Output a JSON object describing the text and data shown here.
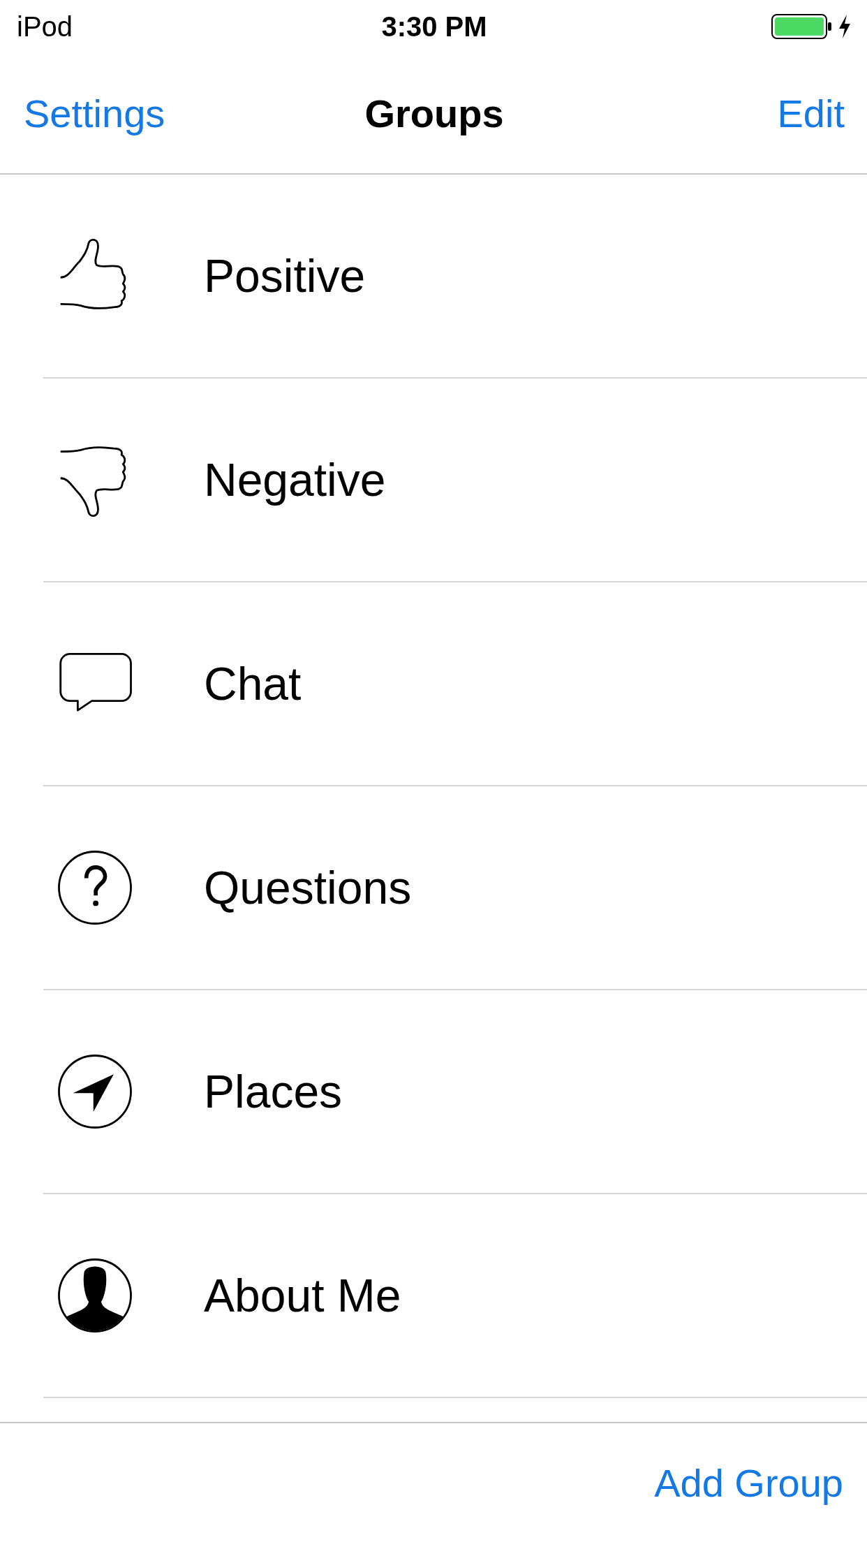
{
  "status_bar": {
    "device": "iPod",
    "time": "3:30 PM"
  },
  "nav_bar": {
    "left_button": "Settings",
    "title": "Groups",
    "right_button": "Edit"
  },
  "groups": [
    {
      "label": "Positive",
      "kind": "thumbs-up"
    },
    {
      "label": "Negative",
      "kind": "thumbs-down"
    },
    {
      "label": "Chat",
      "kind": "chat"
    },
    {
      "label": "Questions",
      "kind": "question"
    },
    {
      "label": "Places",
      "kind": "location"
    },
    {
      "label": "About Me",
      "kind": "person"
    }
  ],
  "toolbar": {
    "button": "Add Group"
  }
}
